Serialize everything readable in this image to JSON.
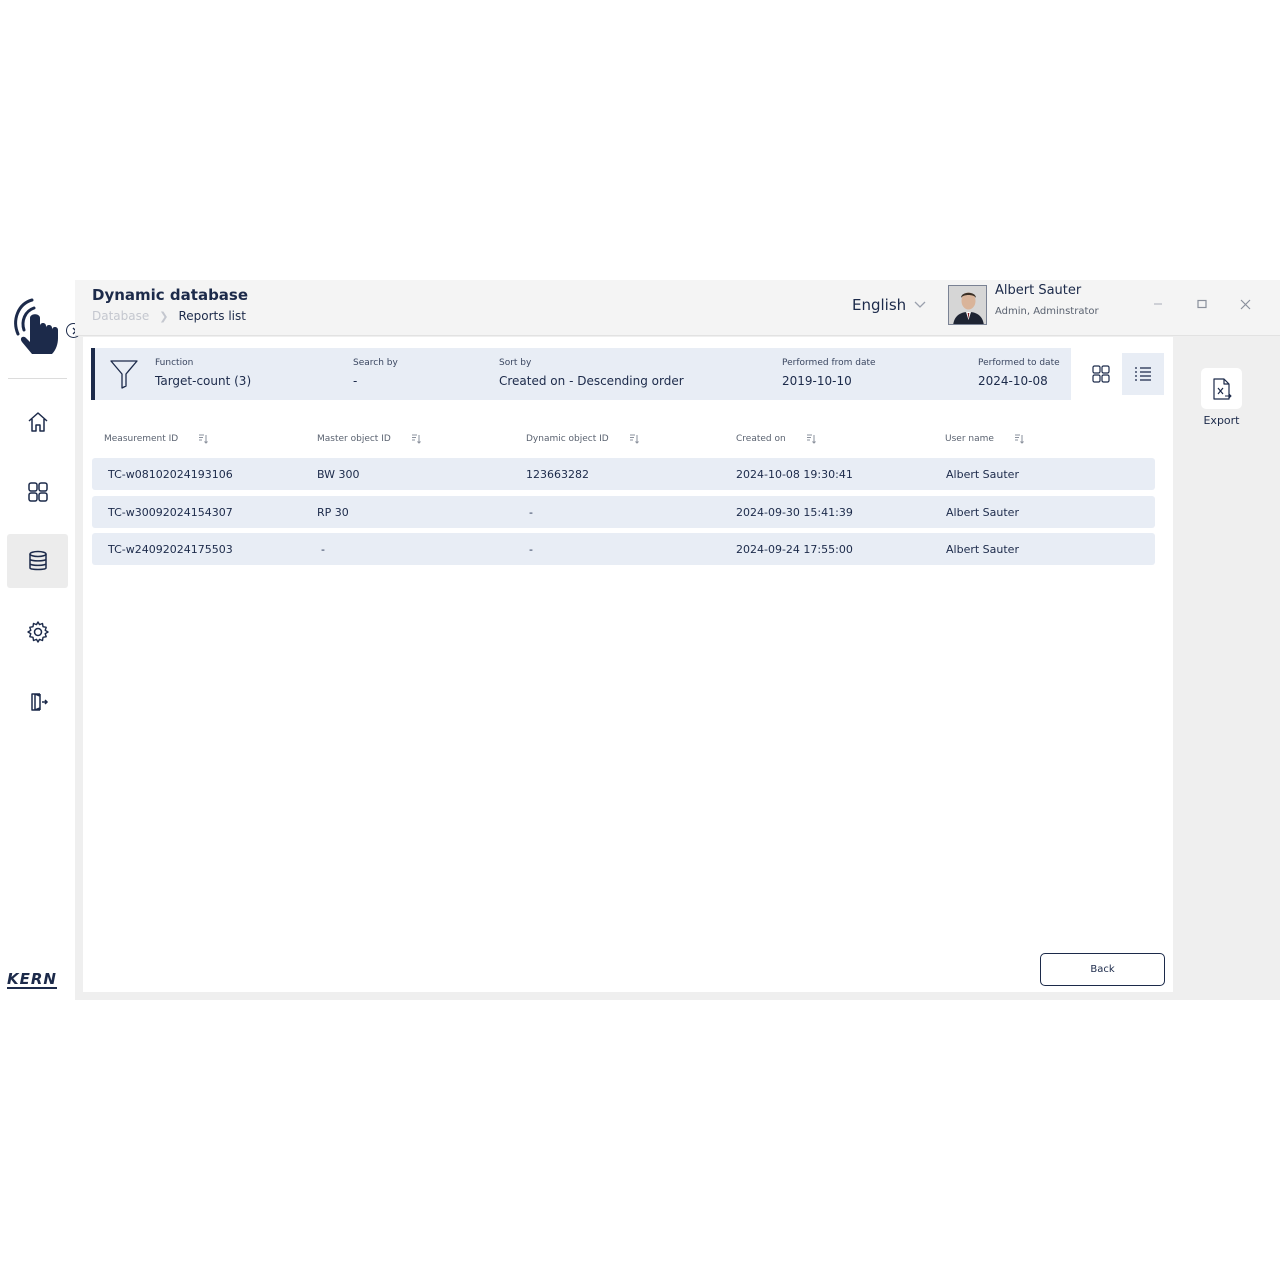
{
  "header": {
    "title": "Dynamic database",
    "breadcrumb": [
      "Database",
      "Reports list"
    ],
    "language": "English",
    "user": {
      "name": "Albert Sauter",
      "role": "Admin, Adminstrator"
    }
  },
  "sidebar": {
    "brand": "KERN",
    "items": [
      {
        "icon": "home-icon",
        "active": false
      },
      {
        "icon": "apps-grid-icon",
        "active": false
      },
      {
        "icon": "database-icon",
        "active": true
      },
      {
        "icon": "gear-icon",
        "active": false
      },
      {
        "icon": "logout-icon",
        "active": false
      }
    ]
  },
  "filters": {
    "function": {
      "label": "Function",
      "value": "Target-count (3)"
    },
    "search_by": {
      "label": "Search by",
      "value": "-"
    },
    "sort_by": {
      "label": "Sort by",
      "value": "Created on - Descending order"
    },
    "from_date": {
      "label": "Performed from date",
      "value": "2019-10-10"
    },
    "to_date": {
      "label": "Performed to date",
      "value": "2024-10-08"
    }
  },
  "table": {
    "columns": [
      "Measurement ID",
      "Master object ID",
      "Dynamic object ID",
      "Created on",
      "User name"
    ],
    "rows": [
      [
        "TC-w08102024193106",
        "BW 300",
        "123663282",
        "2024-10-08 19:30:41",
        "Albert Sauter"
      ],
      [
        "TC-w30092024154307",
        "RP 30",
        "-",
        "2024-09-30 15:41:39",
        "Albert Sauter"
      ],
      [
        "TC-w24092024175503",
        "-",
        "-",
        "2024-09-24 17:55:00",
        "Albert Sauter"
      ]
    ]
  },
  "actions": {
    "export_label": "Export",
    "back_label": "Back"
  },
  "colors": {
    "primary": "#1c2a4a",
    "row_bg": "#e8edf5",
    "panel_bg": "#efefef"
  }
}
